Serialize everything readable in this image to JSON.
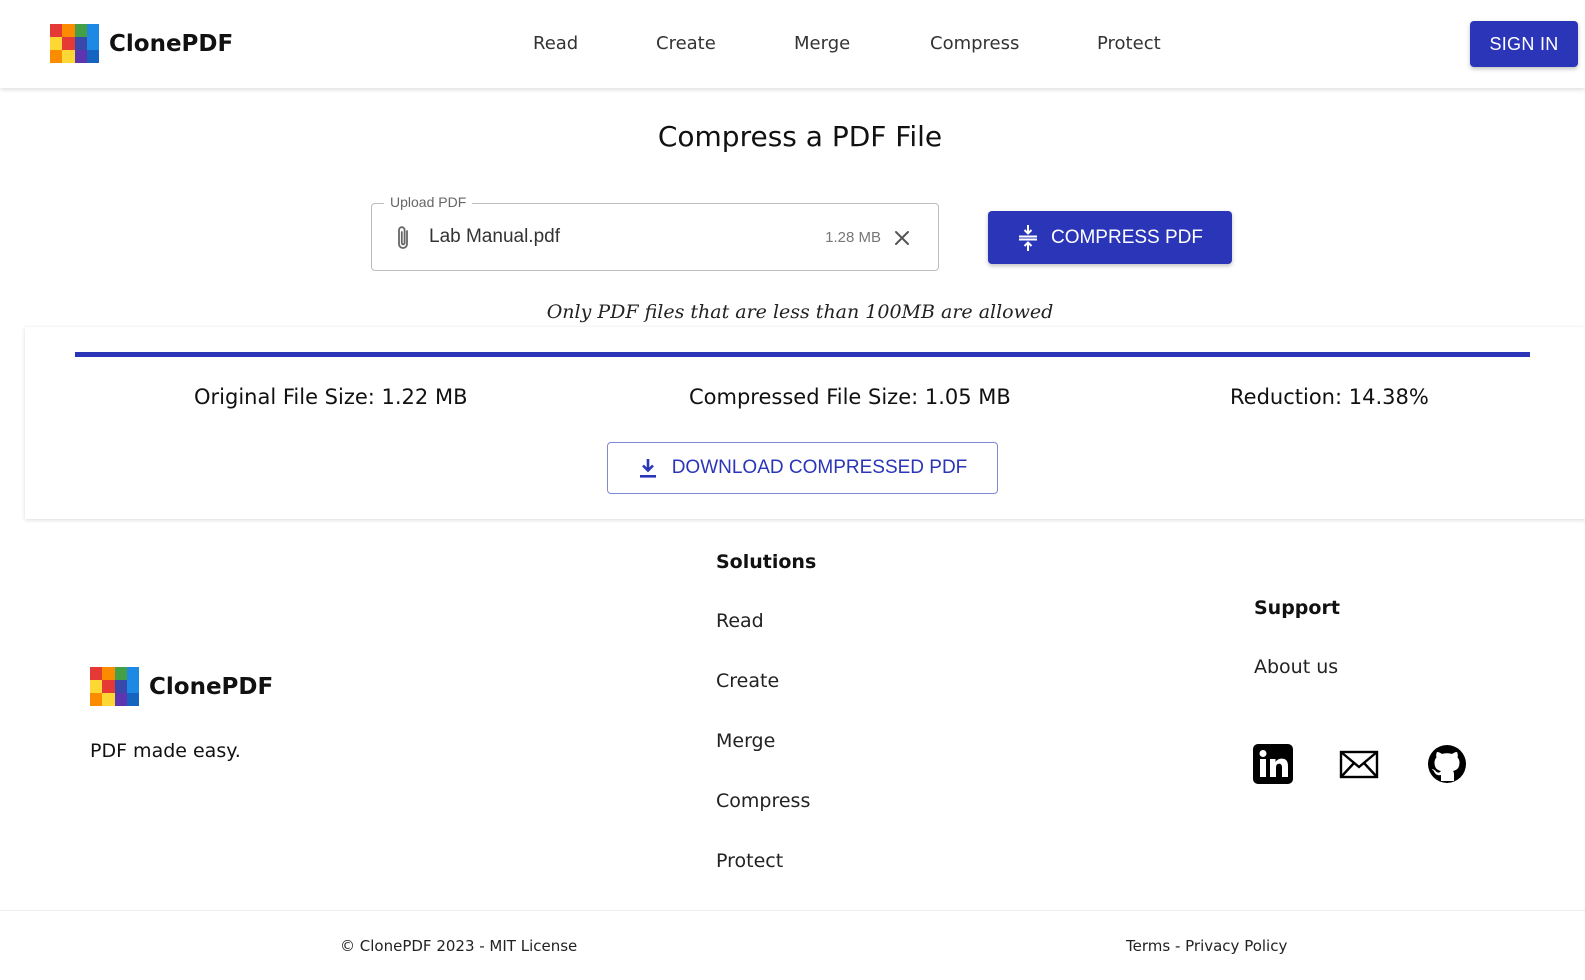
{
  "brand": {
    "name": "ClonePDF",
    "logo_colors": [
      "#e53935",
      "#fb8c00",
      "#43a047",
      "#1e88e5",
      "#fdd835",
      "#e53935",
      "#3949ab",
      "#1e88e5",
      "#fb8c00",
      "#fdd835",
      "#5e35b1",
      "#1565c0"
    ]
  },
  "nav": {
    "items": [
      {
        "label": "Read"
      },
      {
        "label": "Create"
      },
      {
        "label": "Merge"
      },
      {
        "label": "Compress"
      },
      {
        "label": "Protect"
      }
    ],
    "signin_label": "SIGN IN"
  },
  "main": {
    "title": "Compress a PDF File",
    "upload": {
      "legend": "Upload PDF",
      "file_name": "Lab Manual.pdf",
      "file_size": "1.28 MB"
    },
    "compress_button": "COMPRESS PDF",
    "note": "Only PDF files that are less than 100MB are allowed"
  },
  "result": {
    "progress_fraction": 1.0,
    "original": "Original File Size: 1.22 MB",
    "compressed": "Compressed File Size: 1.05 MB",
    "reduction": "Reduction: 14.38%",
    "download_button": "DOWNLOAD COMPRESSED PDF"
  },
  "footer": {
    "brand_name": "ClonePDF",
    "tagline": "PDF made easy.",
    "solutions": {
      "heading": "Solutions",
      "links": [
        "Read",
        "Create",
        "Merge",
        "Compress",
        "Protect"
      ]
    },
    "support": {
      "heading": "Support",
      "links": [
        "About us"
      ]
    },
    "social_icons": [
      "linkedin-icon",
      "mail-icon",
      "github-icon"
    ],
    "copyright": "© ClonePDF 2023 - MIT License",
    "legal": "Terms - Privacy Policy"
  },
  "colors": {
    "primary": "#2a35b8"
  }
}
